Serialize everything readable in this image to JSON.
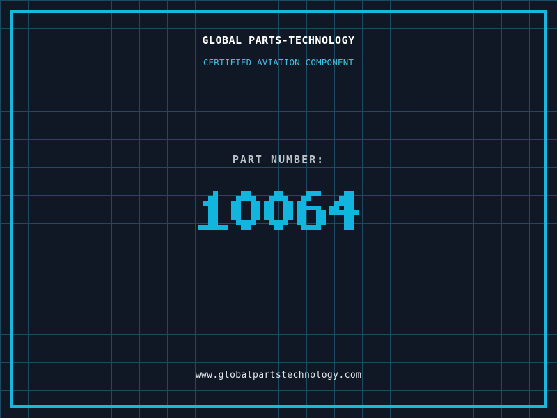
{
  "header": {
    "company_name": "GLOBAL PARTS-TECHNOLOGY",
    "tagline": "CERTIFIED AVIATION COMPONENT"
  },
  "part": {
    "label": "PART NUMBER:",
    "number": "10064"
  },
  "footer": {
    "website": "www.globalpartstechnology.com"
  },
  "colors": {
    "background": "#101826",
    "grid_line": "#1d4b61",
    "frame": "#18b7de",
    "digit": "#12b5dd",
    "title": "#ffffff",
    "tagline": "#41bee2",
    "label": "#bdc3cb",
    "url_text": "#e3e6e9"
  }
}
